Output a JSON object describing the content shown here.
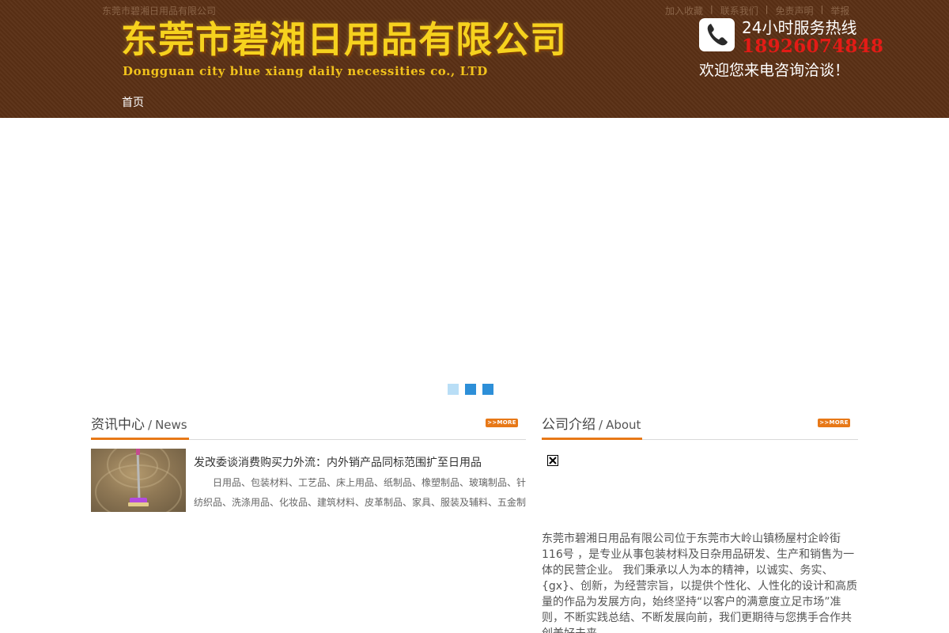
{
  "header": {
    "site_name": "东莞市碧湘日用品有限公司",
    "top_links": [
      "加入收藏",
      "联系我们",
      "免责声明",
      "举报"
    ],
    "logo_cn": "东莞市碧湘日用品有限公司",
    "logo_en": "Dongguan city blue xiang daily necessities co., LTD",
    "hotline_label": "24小时服务热线",
    "hotline_number": "18926074848",
    "hotline_welcome": "欢迎您来电咨询洽谈！",
    "brand_color": "#5a3015",
    "accent_color": "#e77817"
  },
  "nav": {
    "items": [
      {
        "label": "首页"
      }
    ]
  },
  "banner": {
    "slide_count": 3,
    "active_slide": 1
  },
  "news": {
    "title_cn": "资讯中心",
    "slash": "/",
    "title_en": "News",
    "more_label": ">>MORE",
    "items": [
      {
        "title": "发改委谈消费购买力外流：内外销产品同标范围扩至日用品",
        "desc": "日用品、包装材料、工艺品、床上用品、纸制品、橡塑制品、玻璃制品、针纺织品、洗涤用品、化妆品、建筑材料、皮革制品、家具、服装及辅料、五金制"
      }
    ]
  },
  "about": {
    "title_cn": "公司介绍",
    "slash": "/",
    "title_en": "About",
    "more_label": ">>MORE",
    "text": "东莞市碧湘日用品有限公司位于东莞市大岭山镇杨屋村企岭街116号 ，是专业从事包装材料及日杂用品研发、生产和销售为一体的民营企业。 我们秉承以人为本的精神，以诚实、务实、{gx}、创新，为经营宗旨，以提供个性化、人性化的设计和高质量的作品为发展方向，始终坚持“以客户的满意度立足市场”准则，不断实践总结、不断发展向前，我们更期待与您携手合作共创美好未来。"
  }
}
